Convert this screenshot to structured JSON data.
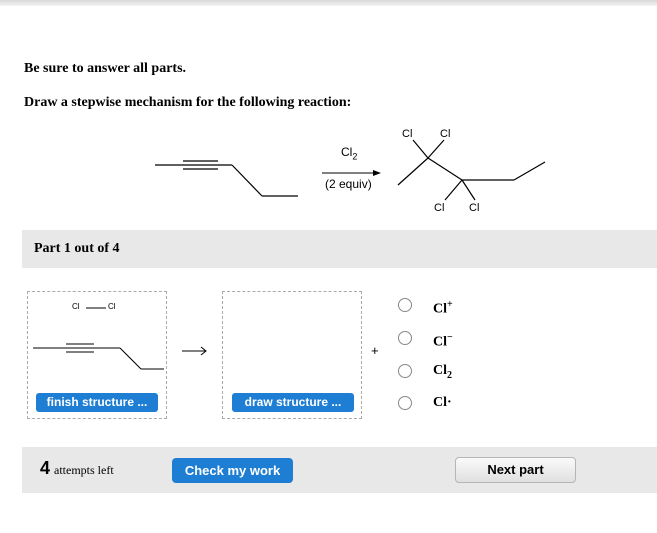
{
  "instructions": {
    "line1": "Be sure to answer all parts.",
    "line2": "Draw a stepwise mechanism for the following reaction:"
  },
  "reaction": {
    "reagent": "Cl2",
    "conditions": "(2 equiv)",
    "product_atoms": [
      "Cl",
      "Cl",
      "Cl",
      "Cl"
    ]
  },
  "part": {
    "title": "Part 1 out of 4"
  },
  "sketch_left": {
    "atom_labels": [
      "Cl",
      "Cl"
    ],
    "button_label": "finish structure ..."
  },
  "sketch_right": {
    "button_label": "draw structure ..."
  },
  "plus_sign": "+",
  "options": [
    {
      "main": "Cl",
      "sup": "+",
      "sub": ""
    },
    {
      "main": "Cl",
      "sup": "−",
      "sub": ""
    },
    {
      "main": "Cl",
      "sup": "",
      "sub": "2"
    },
    {
      "main": "Cl·",
      "sup": "",
      "sub": ""
    }
  ],
  "footer": {
    "attempts_count": "4",
    "attempts_text": "attempts left",
    "check_label": "Check my work",
    "next_label": "Next part"
  }
}
